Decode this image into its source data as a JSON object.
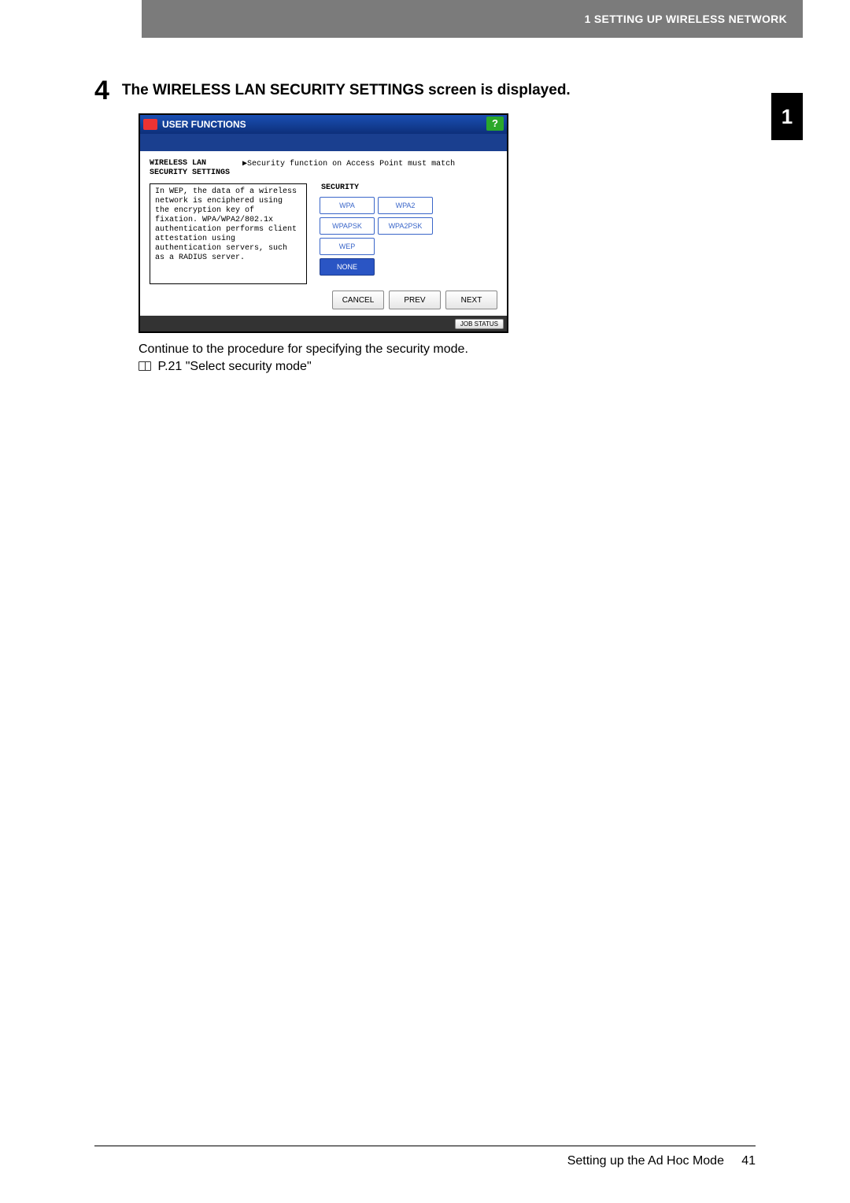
{
  "header": {
    "running_head": "1 SETTING UP WIRELESS NETWORK"
  },
  "chapter_tab": "1",
  "step": {
    "number": "4",
    "title": "The WIRELESS LAN SECURITY SETTINGS screen is displayed."
  },
  "screenshot": {
    "titlebar": "USER FUNCTIONS",
    "help_glyph": "?",
    "left_label": "WIRELESS LAN\nSECURITY SETTINGS",
    "tip": "▶Security function on Access Point must match",
    "description": "In WEP, the data of a wireless network is enciphered using the encryption key of fixation. WPA/WPA2/802.1x authentication performs client attestation using authentication servers, such as a RADIUS server.",
    "security_label": "SECURITY",
    "buttons": {
      "wpa": "WPA",
      "wpa2": "WPA2",
      "wpapsk": "WPAPSK",
      "wpa2psk": "WPA2PSK",
      "wep": "WEP",
      "none": "NONE"
    },
    "nav": {
      "cancel": "CANCEL",
      "prev": "PREV",
      "next": "NEXT"
    },
    "job_status": "JOB STATUS"
  },
  "after": {
    "line1": "Continue to the procedure for specifying the security mode.",
    "line2": "P.21 \"Select security mode\""
  },
  "footer": {
    "section": "Setting up the Ad Hoc Mode",
    "page": "41"
  }
}
